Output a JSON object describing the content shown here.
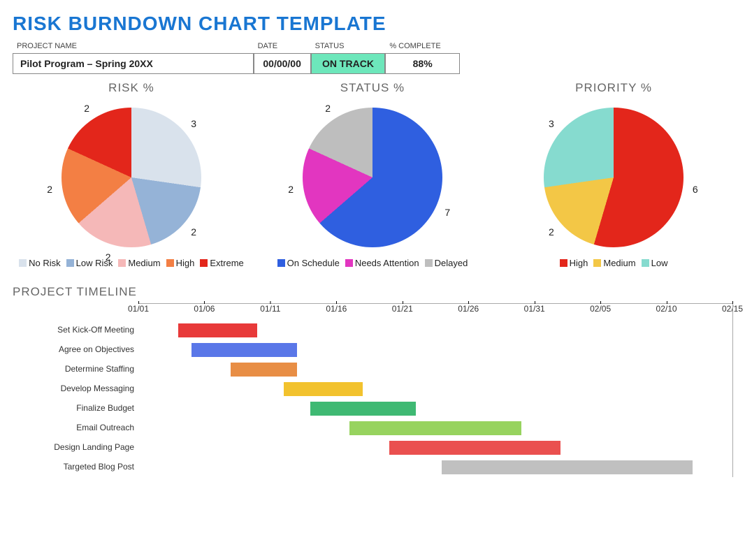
{
  "title": "RISK BURNDOWN CHART TEMPLATE",
  "summary": {
    "headers": {
      "name": "PROJECT NAME",
      "date": "DATE",
      "status": "STATUS",
      "pct": "% COMPLETE"
    },
    "values": {
      "name": "Pilot Program – Spring 20XX",
      "date": "00/00/00",
      "status": "ON TRACK",
      "pct": "88%"
    }
  },
  "charts": {
    "risk": {
      "title": "RISK %",
      "legend": [
        "No Risk",
        "Low Risk",
        "Medium",
        "High",
        "Extreme"
      ]
    },
    "status": {
      "title": "STATUS %",
      "legend": [
        "On Schedule",
        "Needs Attention",
        "Delayed"
      ]
    },
    "priority": {
      "title": "PRIORITY %",
      "legend": [
        "High",
        "Medium",
        "Low"
      ]
    }
  },
  "timeline": {
    "title": "PROJECT TIMELINE",
    "ticks": [
      "01/01",
      "01/06",
      "01/11",
      "01/16",
      "01/21",
      "01/26",
      "01/31",
      "02/05",
      "02/10",
      "02/15"
    ],
    "tasks": [
      "Set Kick-Off Meeting",
      "Agree on Objectives",
      "Determine Staffing",
      "Develop Messaging",
      "Finalize Budget",
      "Email Outreach",
      "Design Landing Page",
      "Targeted Blog Post"
    ]
  },
  "chart_data": [
    {
      "type": "pie",
      "title": "RISK %",
      "series": [
        {
          "name": "No Risk",
          "value": 3,
          "color": "#D9E2EC"
        },
        {
          "name": "Low Risk",
          "value": 2,
          "color": "#95B3D7"
        },
        {
          "name": "Medium",
          "value": 2,
          "color": "#F5B8B8"
        },
        {
          "name": "High",
          "value": 2,
          "color": "#F37F44"
        },
        {
          "name": "Extreme",
          "value": 2,
          "color": "#E3261B"
        }
      ]
    },
    {
      "type": "pie",
      "title": "STATUS %",
      "series": [
        {
          "name": "On Schedule",
          "value": 7,
          "color": "#2F5FE0"
        },
        {
          "name": "Needs Attention",
          "value": 2,
          "color": "#E236C0"
        },
        {
          "name": "Delayed",
          "value": 2,
          "color": "#BEBEBE"
        }
      ]
    },
    {
      "type": "pie",
      "title": "PRIORITY %",
      "series": [
        {
          "name": "High",
          "value": 6,
          "color": "#E3261B"
        },
        {
          "name": "Medium",
          "value": 2,
          "color": "#F3C746"
        },
        {
          "name": "Low",
          "value": 3,
          "color": "#86DBCF"
        }
      ]
    },
    {
      "type": "gantt",
      "title": "PROJECT TIMELINE",
      "x_ticks": [
        "01/01",
        "01/06",
        "01/11",
        "01/16",
        "01/21",
        "01/26",
        "01/31",
        "02/05",
        "02/10",
        "02/15"
      ],
      "x_range": [
        1,
        46
      ],
      "tasks": [
        {
          "name": "Set Kick-Off Meeting",
          "start": 4,
          "end": 10,
          "color": "#E83A3A"
        },
        {
          "name": "Agree on Objectives",
          "start": 5,
          "end": 13,
          "color": "#5A77E8"
        },
        {
          "name": "Determine Staffing",
          "start": 8,
          "end": 13,
          "color": "#E88E45"
        },
        {
          "name": "Develop Messaging",
          "start": 12,
          "end": 18,
          "color": "#F2C22E"
        },
        {
          "name": "Finalize Budget",
          "start": 14,
          "end": 22,
          "color": "#3FB973"
        },
        {
          "name": "Email Outreach",
          "start": 17,
          "end": 30,
          "color": "#97D35F"
        },
        {
          "name": "Design Landing Page",
          "start": 20,
          "end": 33,
          "color": "#EA504F"
        },
        {
          "name": "Targeted Blog Post",
          "start": 24,
          "end": 43,
          "color": "#C0C0C0"
        }
      ]
    }
  ]
}
